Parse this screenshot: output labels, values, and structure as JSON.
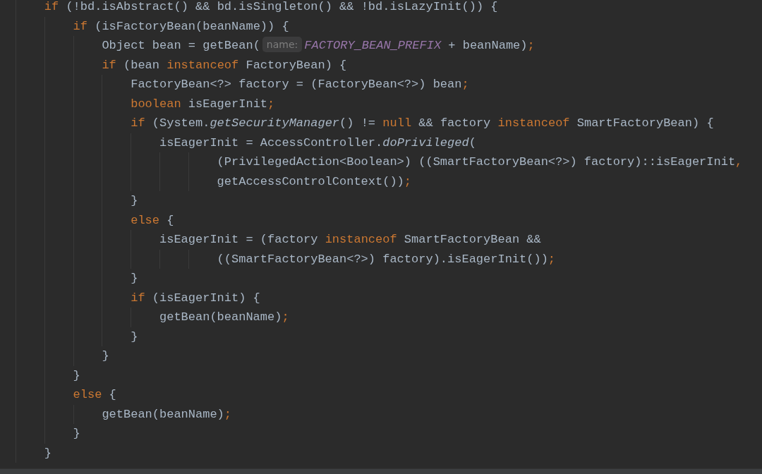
{
  "editor": {
    "lines": [
      {
        "kind": "line",
        "tokens": [
          {
            "kind": "keyword",
            "text": "if"
          },
          {
            "kind": "plain",
            "text": " (!bd.isAbstract() && bd.isSingleton() && !bd.isLazyInit()) {"
          }
        ],
        "children": [
          {
            "kind": "line",
            "tokens": [
              {
                "kind": "keyword",
                "text": "if"
              },
              {
                "kind": "plain",
                "text": " (isFactoryBean(beanName)) {"
              }
            ],
            "children": [
              {
                "kind": "line",
                "tokens": [
                  {
                    "kind": "plain",
                    "text": "Object bean = getBean("
                  },
                  {
                    "kind": "hint",
                    "text": "name:"
                  },
                  {
                    "kind": "constant",
                    "text": "FACTORY_BEAN_PREFIX"
                  },
                  {
                    "kind": "plain",
                    "text": " + beanName)"
                  },
                  {
                    "kind": "keyword",
                    "text": ";"
                  }
                ]
              },
              {
                "kind": "line",
                "tokens": [
                  {
                    "kind": "keyword",
                    "text": "if"
                  },
                  {
                    "kind": "plain",
                    "text": " (bean "
                  },
                  {
                    "kind": "keyword",
                    "text": "instanceof"
                  },
                  {
                    "kind": "plain",
                    "text": " FactoryBean) {"
                  }
                ],
                "children": [
                  {
                    "kind": "line",
                    "tokens": [
                      {
                        "kind": "plain",
                        "text": "FactoryBean<?> factory = (FactoryBean<?>) bean"
                      },
                      {
                        "kind": "keyword",
                        "text": ";"
                      }
                    ]
                  },
                  {
                    "kind": "line",
                    "tokens": [
                      {
                        "kind": "keyword",
                        "text": "boolean"
                      },
                      {
                        "kind": "plain",
                        "text": " isEagerInit"
                      },
                      {
                        "kind": "keyword",
                        "text": ";"
                      }
                    ]
                  },
                  {
                    "kind": "line",
                    "tokens": [
                      {
                        "kind": "keyword",
                        "text": "if"
                      },
                      {
                        "kind": "plain",
                        "text": " (System."
                      },
                      {
                        "kind": "static",
                        "text": "getSecurityManager"
                      },
                      {
                        "kind": "plain",
                        "text": "() != "
                      },
                      {
                        "kind": "keyword",
                        "text": "null"
                      },
                      {
                        "kind": "plain",
                        "text": " && factory "
                      },
                      {
                        "kind": "keyword",
                        "text": "instanceof"
                      },
                      {
                        "kind": "plain",
                        "text": " SmartFactoryBean) {"
                      }
                    ],
                    "children": [
                      {
                        "kind": "line",
                        "tokens": [
                          {
                            "kind": "plain",
                            "text": "isEagerInit = AccessController."
                          },
                          {
                            "kind": "static",
                            "text": "doPrivileged"
                          },
                          {
                            "kind": "plain",
                            "text": "("
                          }
                        ],
                        "children": [
                          {
                            "kind": "wrap",
                            "tokens": [
                              {
                                "kind": "plain",
                                "text": "(PrivilegedAction<Boolean>) ((SmartFactoryBean<?>) factory)::isEagerInit"
                              },
                              {
                                "kind": "keyword",
                                "text": ","
                              }
                            ]
                          },
                          {
                            "kind": "wrap",
                            "tokens": [
                              {
                                "kind": "plain",
                                "text": "getAccessControlContext())"
                              },
                              {
                                "kind": "keyword",
                                "text": ";"
                              }
                            ]
                          }
                        ]
                      }
                    ]
                  },
                  {
                    "kind": "line",
                    "tokens": [
                      {
                        "kind": "plain",
                        "text": "}"
                      }
                    ]
                  },
                  {
                    "kind": "line",
                    "tokens": [
                      {
                        "kind": "keyword",
                        "text": "else"
                      },
                      {
                        "kind": "plain",
                        "text": " {"
                      }
                    ],
                    "children": [
                      {
                        "kind": "line",
                        "tokens": [
                          {
                            "kind": "plain",
                            "text": "isEagerInit = (factory "
                          },
                          {
                            "kind": "keyword",
                            "text": "instanceof"
                          },
                          {
                            "kind": "plain",
                            "text": " SmartFactoryBean &&"
                          }
                        ],
                        "children": [
                          {
                            "kind": "wrap",
                            "tokens": [
                              {
                                "kind": "plain",
                                "text": "((SmartFactoryBean<?>) factory).isEagerInit())"
                              },
                              {
                                "kind": "keyword",
                                "text": ";"
                              }
                            ]
                          }
                        ]
                      }
                    ]
                  },
                  {
                    "kind": "line",
                    "tokens": [
                      {
                        "kind": "plain",
                        "text": "}"
                      }
                    ]
                  },
                  {
                    "kind": "line",
                    "tokens": [
                      {
                        "kind": "keyword",
                        "text": "if"
                      },
                      {
                        "kind": "plain",
                        "text": " (isEagerInit) {"
                      }
                    ],
                    "children": [
                      {
                        "kind": "line",
                        "tokens": [
                          {
                            "kind": "plain",
                            "text": "getBean(beanName)"
                          },
                          {
                            "kind": "keyword",
                            "text": ";"
                          }
                        ]
                      }
                    ]
                  },
                  {
                    "kind": "line",
                    "tokens": [
                      {
                        "kind": "plain",
                        "text": "}"
                      }
                    ]
                  }
                ]
              },
              {
                "kind": "line",
                "tokens": [
                  {
                    "kind": "plain",
                    "text": "}"
                  }
                ]
              }
            ]
          },
          {
            "kind": "line",
            "tokens": [
              {
                "kind": "plain",
                "text": "}"
              }
            ]
          },
          {
            "kind": "line",
            "tokens": [
              {
                "kind": "keyword",
                "text": "else"
              },
              {
                "kind": "plain",
                "text": " {"
              }
            ],
            "children": [
              {
                "kind": "line",
                "tokens": [
                  {
                    "kind": "plain",
                    "text": "getBean(beanName)"
                  },
                  {
                    "kind": "keyword",
                    "text": ";"
                  }
                ]
              }
            ]
          },
          {
            "kind": "line",
            "tokens": [
              {
                "kind": "plain",
                "text": "}"
              }
            ]
          }
        ]
      },
      {
        "kind": "line",
        "tokens": [
          {
            "kind": "plain",
            "text": "}"
          }
        ]
      }
    ]
  }
}
